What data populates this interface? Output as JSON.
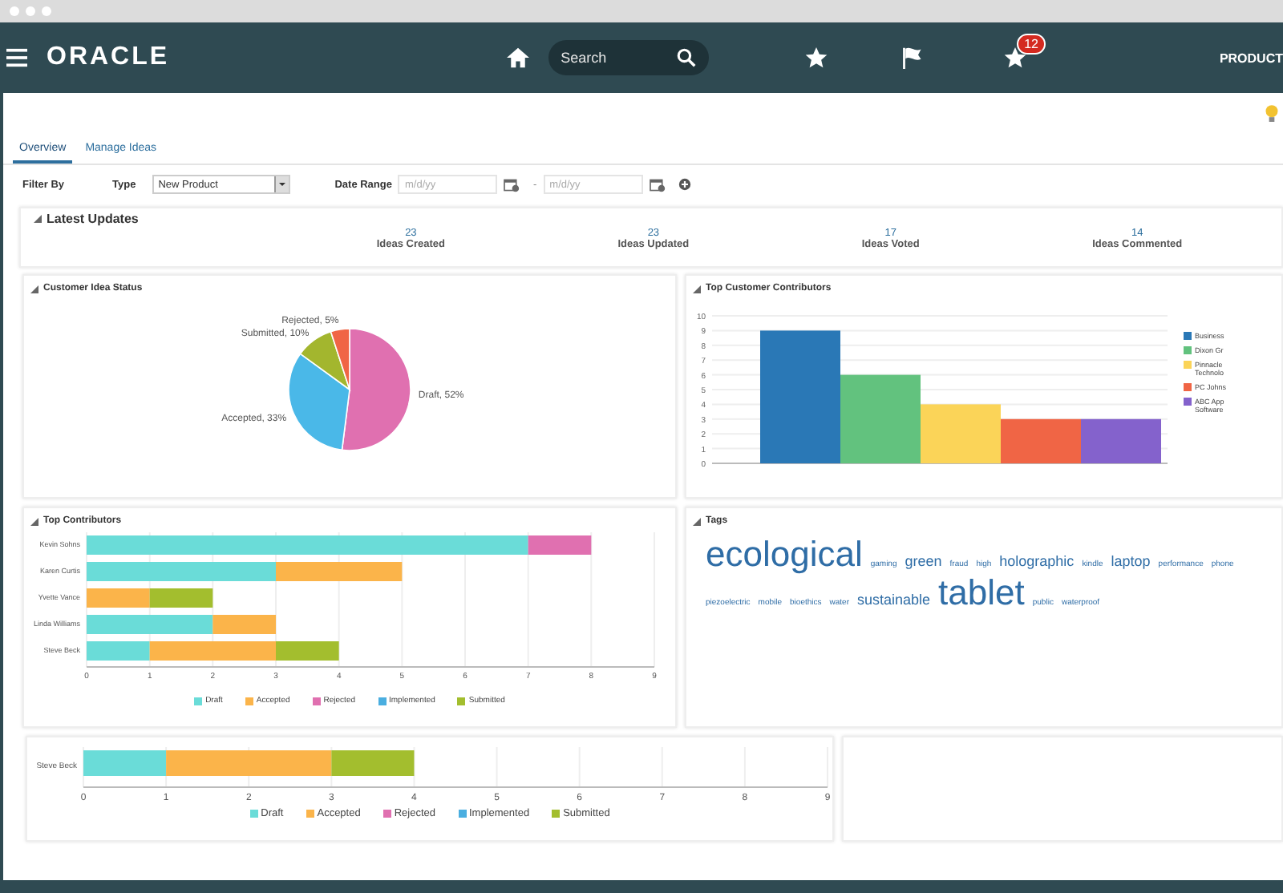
{
  "header": {
    "logo": "ORACLE",
    "search": {
      "placeholder": "Search"
    },
    "notification_count": "12",
    "menu_label": "PRODUCT"
  },
  "tabs": [
    {
      "label": "Overview",
      "selected": true
    },
    {
      "label": "Manage Ideas",
      "selected": false
    }
  ],
  "filter": {
    "title": "Filter By",
    "type_label": "Type",
    "type_value": "New Product",
    "date_label": "Date Range",
    "date_from": {
      "placeholder": "m/d/yy"
    },
    "separator": "-",
    "date_to": {
      "placeholder": "m/d/yy"
    }
  },
  "latest_updates": {
    "title": "Latest Updates",
    "stats": [
      {
        "value": "23",
        "label": "Ideas Created"
      },
      {
        "value": "23",
        "label": "Ideas Updated"
      },
      {
        "value": "17",
        "label": "Ideas Voted"
      },
      {
        "value": "14",
        "label": "Ideas Commented"
      }
    ]
  },
  "customer_idea_status": {
    "title": "Customer Idea Status",
    "chart_data": {
      "type": "pie",
      "values": [
        52,
        33,
        10,
        5
      ],
      "colors": [
        "#e070b0",
        "#4ab8e8",
        "#a3b62e",
        "#f06545"
      ],
      "value_labels": [
        "Draft, 52%",
        "Accepted, 33%",
        "Submitted, 10%",
        "Rejected, 5%"
      ]
    }
  },
  "top_customer_contributors": {
    "title": "Top Customer Contributors",
    "chart_data": {
      "type": "bar",
      "grid": true,
      "legend": true,
      "ylim": [
        0,
        10
      ],
      "yticks": [
        0,
        1,
        2,
        3,
        4,
        5,
        6,
        7,
        8,
        9,
        10
      ],
      "series": [
        {
          "name": "Business",
          "color": "#2a78b6",
          "values": [
            9
          ]
        },
        {
          "name": "Dixon Gr",
          "color": "#62c27e",
          "values": [
            6
          ]
        },
        {
          "name": "Pinnacle Technolo",
          "color": "#fbd458",
          "values": [
            4
          ]
        },
        {
          "name": "PC Johns",
          "color": "#f06545",
          "values": [
            3
          ]
        },
        {
          "name": "ABC App Software",
          "color": "#8462cc",
          "values": [
            3
          ]
        }
      ]
    }
  },
  "top_contributors": {
    "title": "Top Contributors",
    "chart_data": {
      "type": "bar",
      "orientation": "horizontal",
      "stacked": true,
      "grid": true,
      "legend": true,
      "categories": [
        "Kevin Sohns",
        "Karen Curtis",
        "Yvette Vance",
        "Linda Williams",
        "Steve Beck"
      ],
      "xlim": [
        0,
        9
      ],
      "xticks": [
        0,
        1,
        2,
        3,
        4,
        5,
        6,
        7,
        8,
        9
      ],
      "series": [
        {
          "name": "Draft",
          "color": "#6adcd8",
          "values": [
            7,
            3,
            0,
            2,
            1
          ]
        },
        {
          "name": "Accepted",
          "color": "#fbb44a",
          "values": [
            0,
            2,
            1,
            1,
            2
          ]
        },
        {
          "name": "Rejected",
          "color": "#e070b0",
          "values": [
            1,
            0,
            0,
            0,
            0
          ]
        },
        {
          "name": "Implemented",
          "color": "#4aaee0",
          "values": [
            0,
            0,
            0,
            0,
            0
          ]
        },
        {
          "name": "Submitted",
          "color": "#a3be2e",
          "values": [
            0,
            0,
            1,
            0,
            1
          ]
        }
      ]
    }
  },
  "tags": {
    "title": "Tags",
    "items": [
      {
        "text": "ecological",
        "kind": "xl"
      },
      {
        "text": "gaming",
        "kind": "s"
      },
      {
        "text": "green",
        "kind": "m"
      },
      {
        "text": "fraud",
        "kind": "s"
      },
      {
        "text": "high",
        "kind": "s"
      },
      {
        "text": "holographic",
        "kind": "m"
      },
      {
        "text": "kindle",
        "kind": "s"
      },
      {
        "text": "laptop",
        "kind": "m"
      },
      {
        "text": "performance",
        "kind": "s"
      },
      {
        "text": "phone",
        "kind": "s"
      },
      {
        "text": "piezoelectric",
        "kind": "s"
      },
      {
        "text": "mobile",
        "kind": "s"
      },
      {
        "text": "bioethics",
        "kind": "s"
      },
      {
        "text": "water",
        "kind": "s"
      },
      {
        "text": "sustainable",
        "kind": "m"
      },
      {
        "text": "tablet",
        "kind": "xl"
      },
      {
        "text": "public",
        "kind": "s"
      },
      {
        "text": "waterproof",
        "kind": "s"
      }
    ]
  },
  "contributor_detail": {
    "chart_data": {
      "type": "bar",
      "orientation": "horizontal",
      "stacked": true,
      "grid": true,
      "legend": true,
      "categories": [
        "Steve Beck"
      ],
      "xlim": [
        0,
        9
      ],
      "xticks": [
        0,
        1,
        2,
        3,
        4,
        5,
        6,
        7,
        8,
        9
      ],
      "series": [
        {
          "name": "Draft",
          "color": "#6adcd8",
          "values": [
            1
          ]
        },
        {
          "name": "Accepted",
          "color": "#fbb44a",
          "values": [
            2
          ]
        },
        {
          "name": "Rejected",
          "color": "#e070b0",
          "values": [
            0
          ]
        },
        {
          "name": "Implemented",
          "color": "#4aaee0",
          "values": [
            0
          ]
        },
        {
          "name": "Submitted",
          "color": "#a3be2e",
          "values": [
            1
          ]
        }
      ]
    }
  }
}
